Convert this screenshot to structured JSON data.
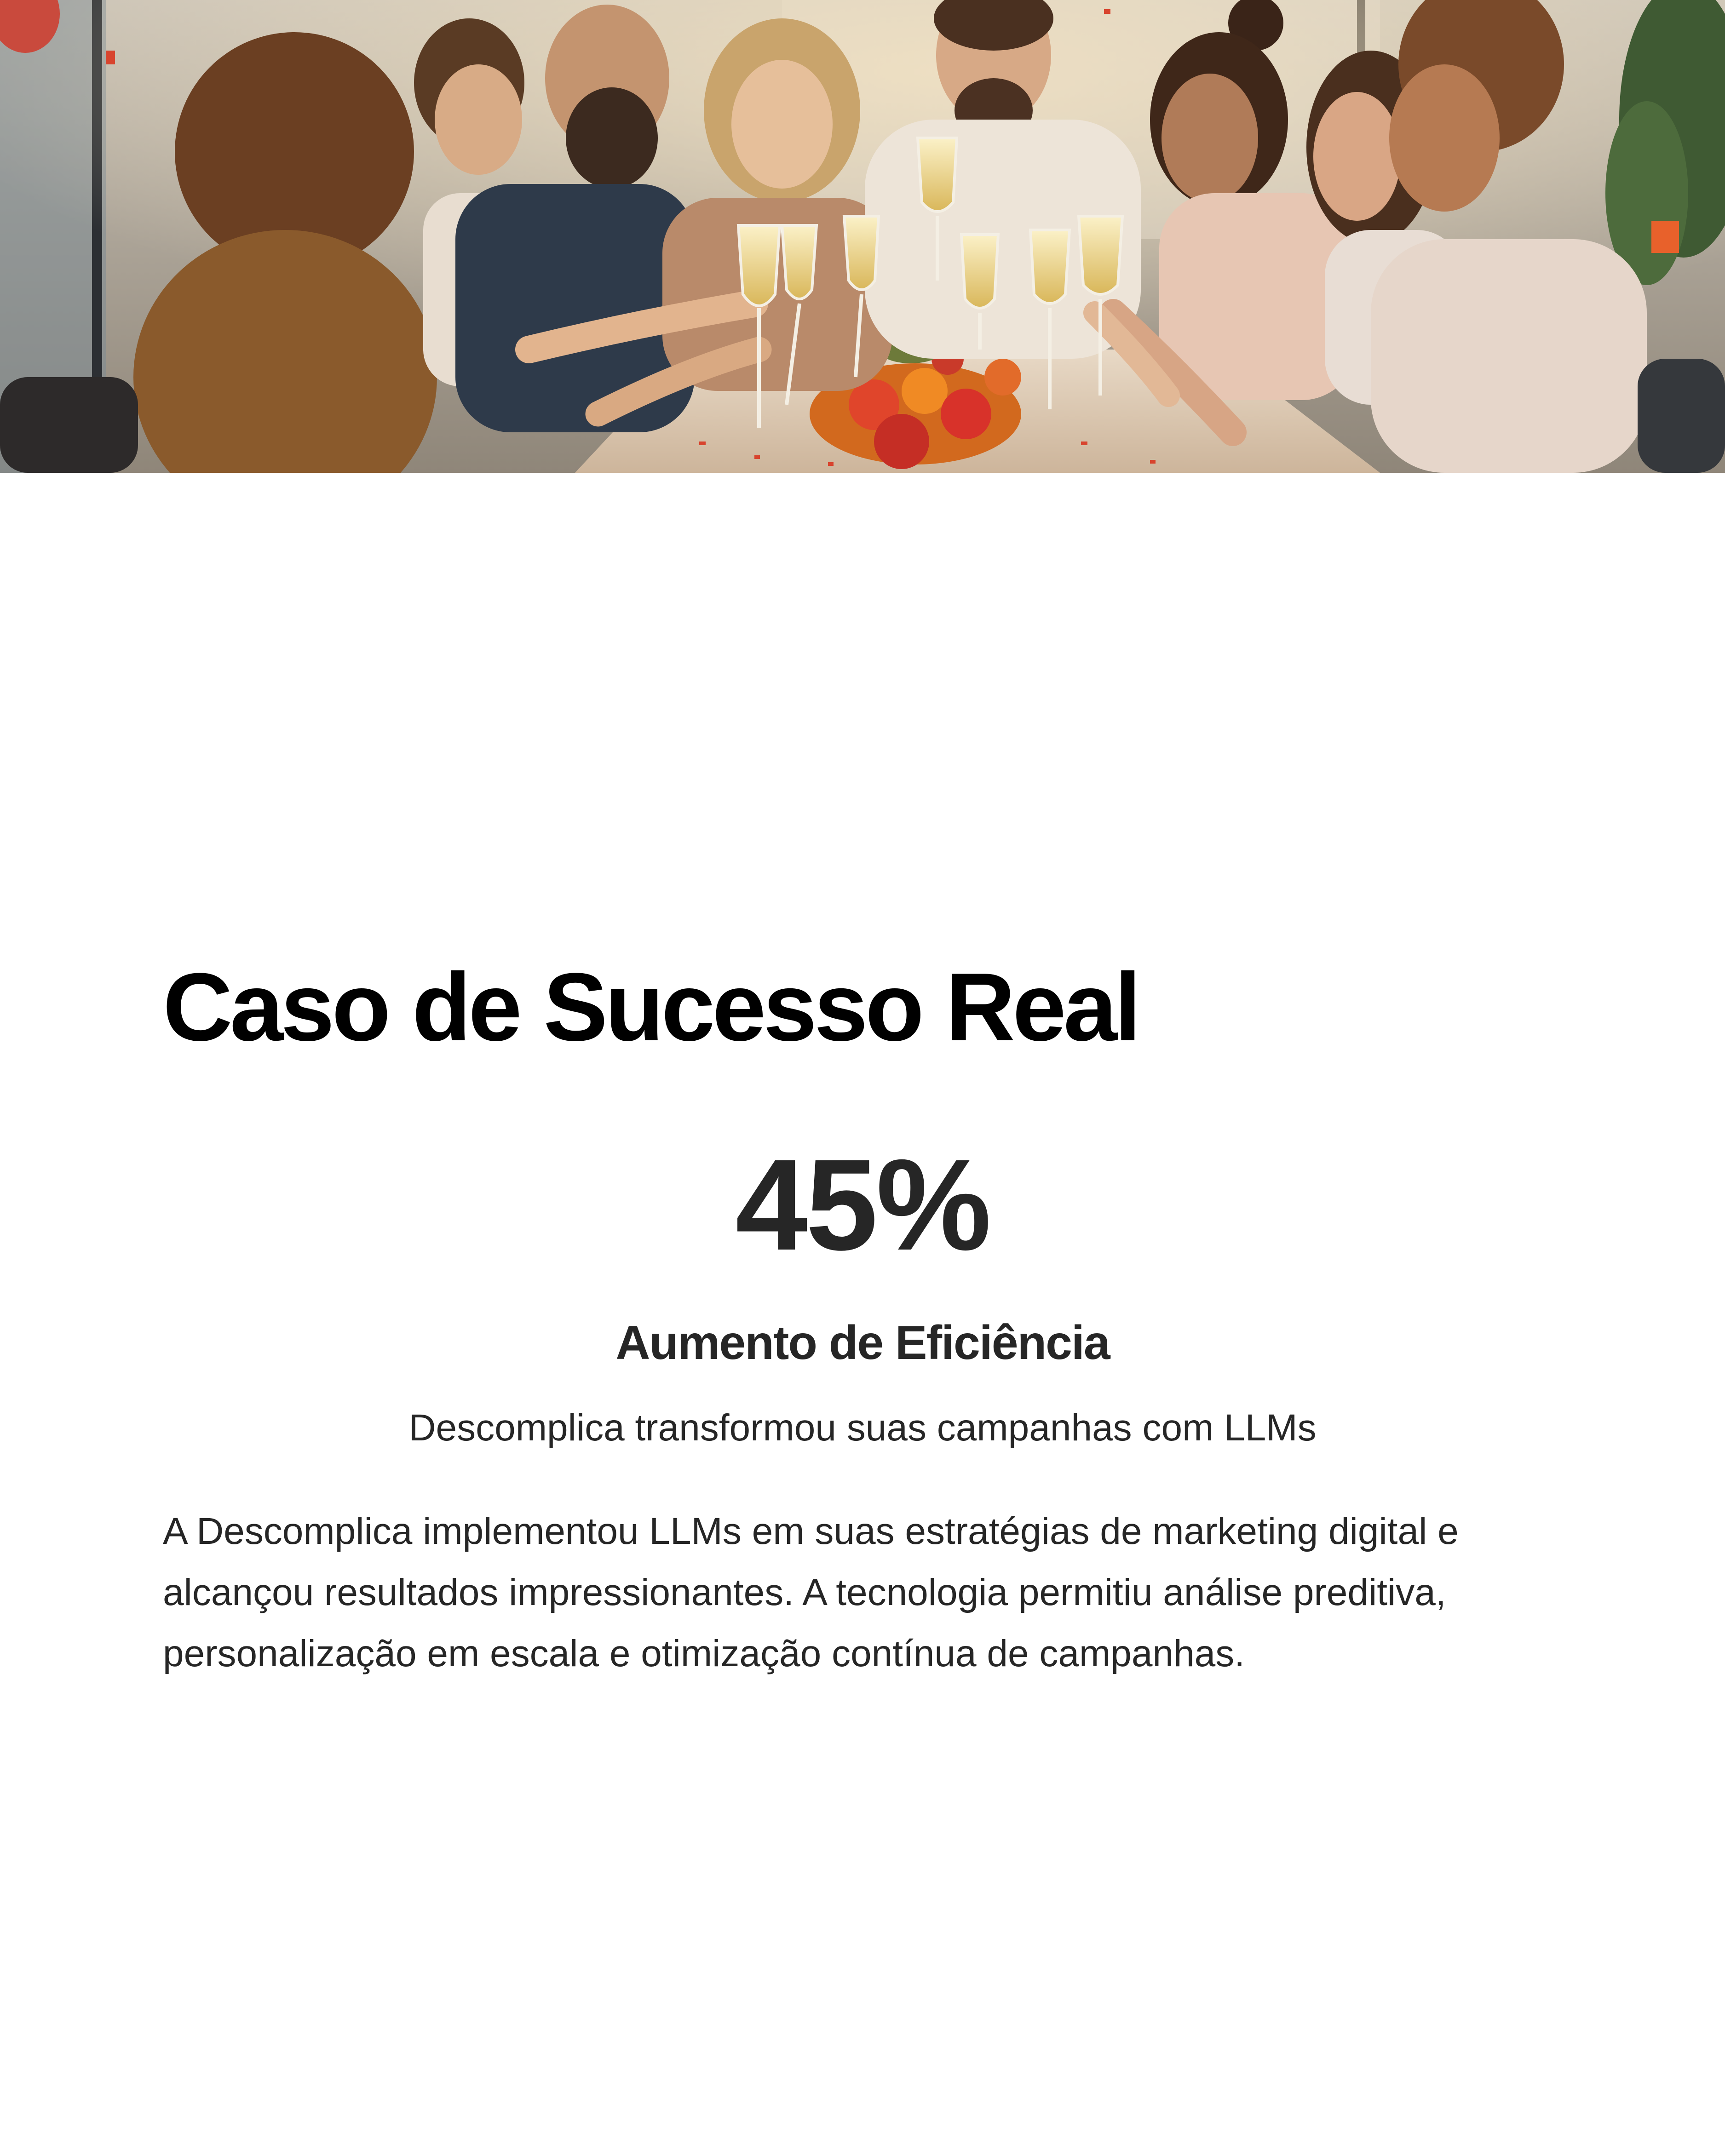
{
  "hero": {
    "image_description": "celebration-photo"
  },
  "section": {
    "title": "Caso de Sucesso Real",
    "stat_value": "45%",
    "stat_label": "Aumento de Eficiência",
    "stat_caption": "Descomplica transformou suas campanhas com LLMs",
    "body": "A Descomplica implementou LLMs em suas estratégias de marketing digital e alcançou resultados impressionantes. A tecnologia permitiu análise preditiva, personalização em escala e otimização contínua de campanhas."
  },
  "colors": {
    "title": "#000000",
    "text": "#262626",
    "background": "#ffffff"
  }
}
